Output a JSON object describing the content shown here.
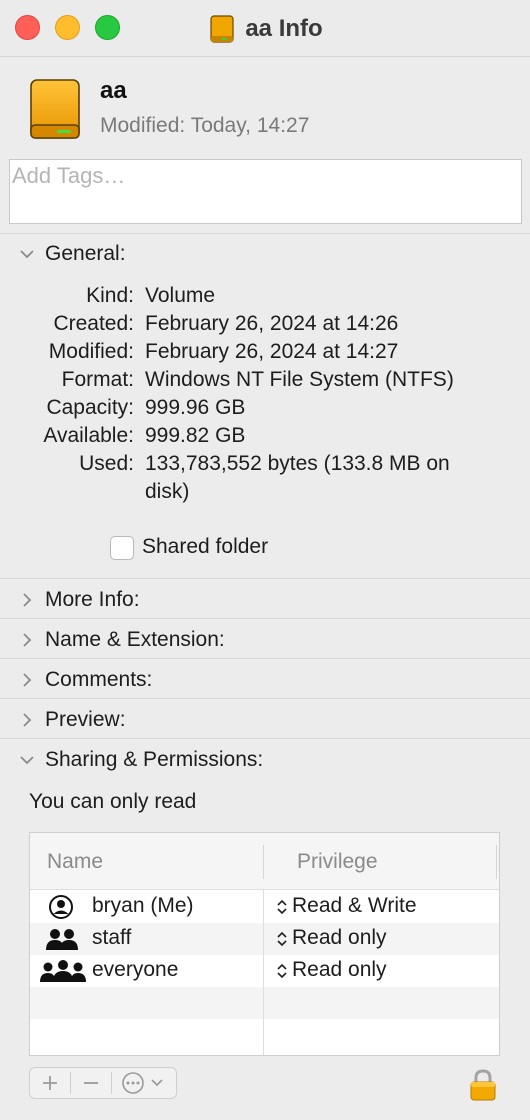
{
  "window": {
    "title": "aa Info"
  },
  "header": {
    "name": "aa",
    "modified_label": "Modified:",
    "modified_value": "Today, 14:27"
  },
  "tags": {
    "placeholder": "Add Tags…"
  },
  "general": {
    "title": "General:",
    "expanded": true,
    "rows": [
      {
        "key": "Kind:",
        "value": "Volume"
      },
      {
        "key": "Created:",
        "value": "February 26, 2024 at 14:26"
      },
      {
        "key": "Modified:",
        "value": "February 26, 2024 at 14:27"
      },
      {
        "key": "Format:",
        "value": "Windows NT File System (NTFS)"
      },
      {
        "key": "Capacity:",
        "value": "999.96 GB"
      },
      {
        "key": "Available:",
        "value": "999.82 GB"
      },
      {
        "key": "Used:",
        "value": "133,783,552 bytes (133.8 MB on disk)"
      }
    ],
    "shared_folder_label": "Shared folder",
    "shared_folder_checked": false
  },
  "sections": {
    "more_info": "More Info:",
    "name_extension": "Name & Extension:",
    "comments": "Comments:",
    "preview": "Preview:",
    "sharing": "Sharing & Permissions:"
  },
  "sharing": {
    "note": "You can only read",
    "columns": {
      "name": "Name",
      "privilege": "Privilege"
    },
    "rows": [
      {
        "name": "bryan (Me)",
        "privilege": "Read & Write",
        "icon": "user-circle-icon"
      },
      {
        "name": "staff",
        "privilege": "Read only",
        "icon": "group-icon"
      },
      {
        "name": "everyone",
        "privilege": "Read only",
        "icon": "everyone-icon"
      }
    ]
  },
  "toolbar": {
    "add": "+",
    "remove": "—",
    "action": "action-menu-icon"
  },
  "colors": {
    "close": "#fe5f57",
    "minimize": "#febc2e",
    "zoom": "#28c840",
    "drive": "#f0a500"
  }
}
